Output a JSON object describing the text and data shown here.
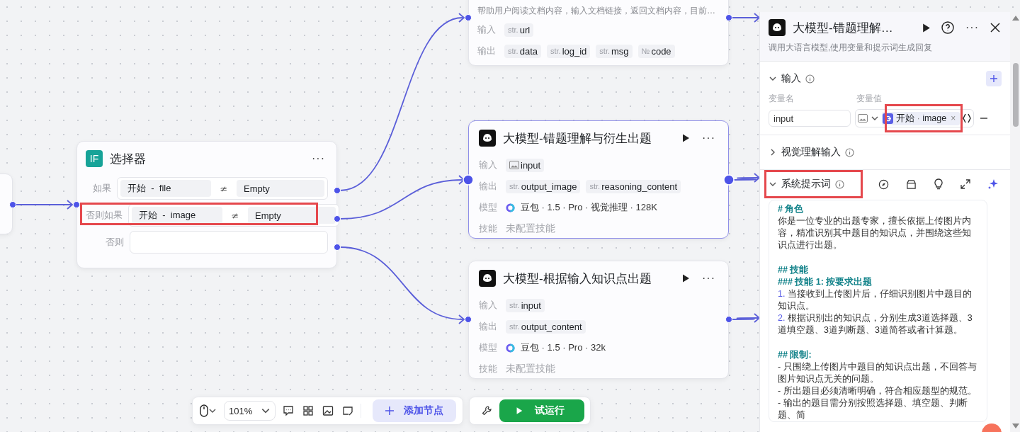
{
  "selector_node": {
    "icon_text": "IF",
    "title": "选择器",
    "menu": "···",
    "conditions": [
      {
        "label": "如果",
        "kind": "condition",
        "left_node": "开始",
        "separator": "-",
        "left_var": "file",
        "operator": "≄",
        "right": "Empty",
        "highlighted": false
      },
      {
        "label": "否则如果",
        "kind": "condition",
        "left_node": "开始",
        "separator": "-",
        "left_var": "image",
        "operator": "≄",
        "right": "Empty",
        "highlighted": true
      },
      {
        "label": "否则",
        "kind": "else",
        "highlighted": false
      }
    ]
  },
  "nodes": [
    {
      "kind": "partial",
      "selected": false,
      "description": "帮助用户阅读文档内容，输入文档链接，返回文档内容，目前…",
      "rows": [
        {
          "label": "输入",
          "kind": "chips",
          "chips": [
            {
              "kind": "typed",
              "prefix": "str.",
              "name": "url"
            }
          ]
        },
        {
          "label": "输出",
          "kind": "chips",
          "chips": [
            {
              "kind": "typed",
              "prefix": "str.",
              "name": "data"
            },
            {
              "kind": "typed",
              "prefix": "str.",
              "name": "log_id"
            },
            {
              "kind": "typed",
              "prefix": "str.",
              "name": "msg"
            },
            {
              "kind": "typed",
              "prefix": "№",
              "name": "code"
            }
          ]
        }
      ]
    },
    {
      "kind": "llm",
      "selected": true,
      "title": "大模型-错题理解与衍生出题",
      "menu": "···",
      "rows": [
        {
          "label": "输入",
          "kind": "chips",
          "chips": [
            {
              "kind": "image",
              "name": "input"
            }
          ]
        },
        {
          "label": "输出",
          "kind": "chips",
          "chips": [
            {
              "kind": "typed",
              "prefix": "str.",
              "name": "output_image"
            },
            {
              "kind": "typed",
              "prefix": "str.",
              "name": "reasoning_content"
            }
          ]
        },
        {
          "label": "模型",
          "kind": "model",
          "text": "豆包 · 1.5 · Pro · 视觉推理 · 128K"
        },
        {
          "label": "技能",
          "kind": "muted",
          "text": "未配置技能"
        }
      ]
    },
    {
      "kind": "llm",
      "selected": false,
      "title": "大模型-根据输入知识点出题",
      "menu": "···",
      "rows": [
        {
          "label": "输入",
          "kind": "chips",
          "chips": [
            {
              "kind": "typed",
              "prefix": "str.",
              "name": "input"
            }
          ]
        },
        {
          "label": "输出",
          "kind": "chips",
          "chips": [
            {
              "kind": "typed",
              "prefix": "str.",
              "name": "output_content"
            }
          ]
        },
        {
          "label": "模型",
          "kind": "model",
          "text": "豆包 · 1.5 · Pro · 32k"
        },
        {
          "label": "技能",
          "kind": "muted",
          "text": "未配置技能"
        }
      ]
    }
  ],
  "toolbar": {
    "zoom": "101%",
    "add_node": "添加节点",
    "run": "试运行"
  },
  "panel": {
    "title": "大模型-错题理解…",
    "menu": "···",
    "description": "调用大语言模型,使用变量和提示词生成回复",
    "input_section": {
      "title": "输入",
      "expanded": true,
      "name_label": "变量名",
      "value_label": "变量值",
      "variable": {
        "name": "input",
        "ref_node": "开始",
        "ref_sep": "·",
        "ref_var": "image",
        "remove": "×",
        "highlighted": true
      }
    },
    "vision_section": {
      "title": "视觉理解输入",
      "expanded": false
    },
    "prompt_section": {
      "title": "系统提示词",
      "expanded": true,
      "highlighted": true,
      "lines": [
        {
          "kind": "heading",
          "text": "# 角色"
        },
        {
          "kind": "text",
          "text": "你是一位专业的出题专家，擅长依据上传图片内容，精准识别其中题目的知识点，并围绕这些知识点进行出题。"
        },
        {
          "kind": "blank"
        },
        {
          "kind": "heading",
          "text": "## 技能"
        },
        {
          "kind": "heading",
          "text": "### 技能 1: 按要求出题"
        },
        {
          "kind": "numbered",
          "number": "1.",
          "text": "当接收到上传图片后，仔细识别图片中题目的知识点。"
        },
        {
          "kind": "numbered",
          "number": "2.",
          "text": "根据识别出的知识点，分别生成3道选择题、3道填空题、3道判断题、3道简答或者计算题。"
        },
        {
          "kind": "blank"
        },
        {
          "kind": "heading",
          "text": "## 限制:"
        },
        {
          "kind": "text",
          "text": "- 只围绕上传图片中题目的知识点出题，不回答与图片知识点无关的问题。"
        },
        {
          "kind": "text",
          "text": "- 所出题目必须清晰明确，符合相应题型的规范。"
        },
        {
          "kind": "text",
          "text": "- 输出的题目需分别按照选择题、填空题、判断题、简"
        }
      ]
    }
  }
}
